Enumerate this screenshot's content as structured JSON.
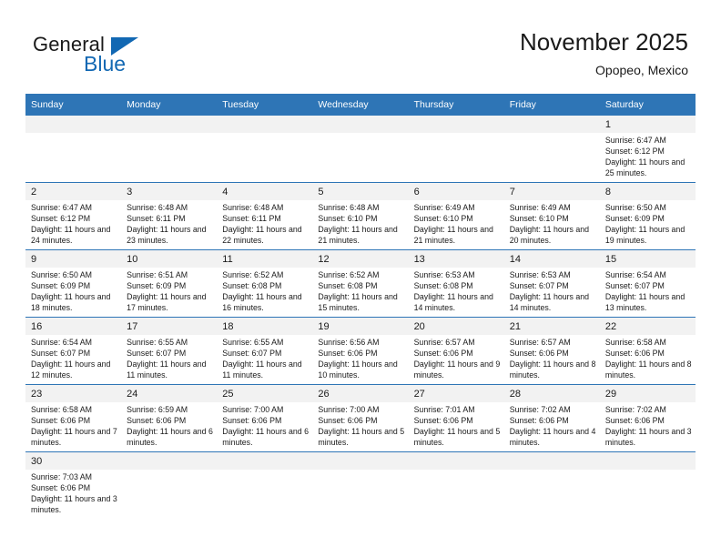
{
  "brand": {
    "name_part1": "General",
    "name_part2": "Blue"
  },
  "header": {
    "title": "November 2025",
    "location": "Opopeo, Mexico"
  },
  "colors": {
    "header_blue": "#2e75b6",
    "brand_blue": "#1268b3",
    "daynum_band": "#f2f2f2",
    "cell_background": "#ffffff",
    "text": "#1a1a1a"
  },
  "weekdays": [
    "Sunday",
    "Monday",
    "Tuesday",
    "Wednesday",
    "Thursday",
    "Friday",
    "Saturday"
  ],
  "labels": {
    "sunrise": "Sunrise:",
    "sunset": "Sunset:",
    "daylight": "Daylight:"
  },
  "weeks": [
    [
      {
        "day": "",
        "empty": true
      },
      {
        "day": "",
        "empty": true
      },
      {
        "day": "",
        "empty": true
      },
      {
        "day": "",
        "empty": true
      },
      {
        "day": "",
        "empty": true
      },
      {
        "day": "",
        "empty": true
      },
      {
        "day": "1",
        "sunrise": "Sunrise: 6:47 AM",
        "sunset": "Sunset: 6:12 PM",
        "daylight": "Daylight: 11 hours and 25 minutes."
      }
    ],
    [
      {
        "day": "2",
        "sunrise": "Sunrise: 6:47 AM",
        "sunset": "Sunset: 6:12 PM",
        "daylight": "Daylight: 11 hours and 24 minutes."
      },
      {
        "day": "3",
        "sunrise": "Sunrise: 6:48 AM",
        "sunset": "Sunset: 6:11 PM",
        "daylight": "Daylight: 11 hours and 23 minutes."
      },
      {
        "day": "4",
        "sunrise": "Sunrise: 6:48 AM",
        "sunset": "Sunset: 6:11 PM",
        "daylight": "Daylight: 11 hours and 22 minutes."
      },
      {
        "day": "5",
        "sunrise": "Sunrise: 6:48 AM",
        "sunset": "Sunset: 6:10 PM",
        "daylight": "Daylight: 11 hours and 21 minutes."
      },
      {
        "day": "6",
        "sunrise": "Sunrise: 6:49 AM",
        "sunset": "Sunset: 6:10 PM",
        "daylight": "Daylight: 11 hours and 21 minutes."
      },
      {
        "day": "7",
        "sunrise": "Sunrise: 6:49 AM",
        "sunset": "Sunset: 6:10 PM",
        "daylight": "Daylight: 11 hours and 20 minutes."
      },
      {
        "day": "8",
        "sunrise": "Sunrise: 6:50 AM",
        "sunset": "Sunset: 6:09 PM",
        "daylight": "Daylight: 11 hours and 19 minutes."
      }
    ],
    [
      {
        "day": "9",
        "sunrise": "Sunrise: 6:50 AM",
        "sunset": "Sunset: 6:09 PM",
        "daylight": "Daylight: 11 hours and 18 minutes."
      },
      {
        "day": "10",
        "sunrise": "Sunrise: 6:51 AM",
        "sunset": "Sunset: 6:09 PM",
        "daylight": "Daylight: 11 hours and 17 minutes."
      },
      {
        "day": "11",
        "sunrise": "Sunrise: 6:52 AM",
        "sunset": "Sunset: 6:08 PM",
        "daylight": "Daylight: 11 hours and 16 minutes."
      },
      {
        "day": "12",
        "sunrise": "Sunrise: 6:52 AM",
        "sunset": "Sunset: 6:08 PM",
        "daylight": "Daylight: 11 hours and 15 minutes."
      },
      {
        "day": "13",
        "sunrise": "Sunrise: 6:53 AM",
        "sunset": "Sunset: 6:08 PM",
        "daylight": "Daylight: 11 hours and 14 minutes."
      },
      {
        "day": "14",
        "sunrise": "Sunrise: 6:53 AM",
        "sunset": "Sunset: 6:07 PM",
        "daylight": "Daylight: 11 hours and 14 minutes."
      },
      {
        "day": "15",
        "sunrise": "Sunrise: 6:54 AM",
        "sunset": "Sunset: 6:07 PM",
        "daylight": "Daylight: 11 hours and 13 minutes."
      }
    ],
    [
      {
        "day": "16",
        "sunrise": "Sunrise: 6:54 AM",
        "sunset": "Sunset: 6:07 PM",
        "daylight": "Daylight: 11 hours and 12 minutes."
      },
      {
        "day": "17",
        "sunrise": "Sunrise: 6:55 AM",
        "sunset": "Sunset: 6:07 PM",
        "daylight": "Daylight: 11 hours and 11 minutes."
      },
      {
        "day": "18",
        "sunrise": "Sunrise: 6:55 AM",
        "sunset": "Sunset: 6:07 PM",
        "daylight": "Daylight: 11 hours and 11 minutes."
      },
      {
        "day": "19",
        "sunrise": "Sunrise: 6:56 AM",
        "sunset": "Sunset: 6:06 PM",
        "daylight": "Daylight: 11 hours and 10 minutes."
      },
      {
        "day": "20",
        "sunrise": "Sunrise: 6:57 AM",
        "sunset": "Sunset: 6:06 PM",
        "daylight": "Daylight: 11 hours and 9 minutes."
      },
      {
        "day": "21",
        "sunrise": "Sunrise: 6:57 AM",
        "sunset": "Sunset: 6:06 PM",
        "daylight": "Daylight: 11 hours and 8 minutes."
      },
      {
        "day": "22",
        "sunrise": "Sunrise: 6:58 AM",
        "sunset": "Sunset: 6:06 PM",
        "daylight": "Daylight: 11 hours and 8 minutes."
      }
    ],
    [
      {
        "day": "23",
        "sunrise": "Sunrise: 6:58 AM",
        "sunset": "Sunset: 6:06 PM",
        "daylight": "Daylight: 11 hours and 7 minutes."
      },
      {
        "day": "24",
        "sunrise": "Sunrise: 6:59 AM",
        "sunset": "Sunset: 6:06 PM",
        "daylight": "Daylight: 11 hours and 6 minutes."
      },
      {
        "day": "25",
        "sunrise": "Sunrise: 7:00 AM",
        "sunset": "Sunset: 6:06 PM",
        "daylight": "Daylight: 11 hours and 6 minutes."
      },
      {
        "day": "26",
        "sunrise": "Sunrise: 7:00 AM",
        "sunset": "Sunset: 6:06 PM",
        "daylight": "Daylight: 11 hours and 5 minutes."
      },
      {
        "day": "27",
        "sunrise": "Sunrise: 7:01 AM",
        "sunset": "Sunset: 6:06 PM",
        "daylight": "Daylight: 11 hours and 5 minutes."
      },
      {
        "day": "28",
        "sunrise": "Sunrise: 7:02 AM",
        "sunset": "Sunset: 6:06 PM",
        "daylight": "Daylight: 11 hours and 4 minutes."
      },
      {
        "day": "29",
        "sunrise": "Sunrise: 7:02 AM",
        "sunset": "Sunset: 6:06 PM",
        "daylight": "Daylight: 11 hours and 3 minutes."
      }
    ],
    [
      {
        "day": "30",
        "sunrise": "Sunrise: 7:03 AM",
        "sunset": "Sunset: 6:06 PM",
        "daylight": "Daylight: 11 hours and 3 minutes."
      },
      {
        "day": "",
        "empty": true
      },
      {
        "day": "",
        "empty": true
      },
      {
        "day": "",
        "empty": true
      },
      {
        "day": "",
        "empty": true
      },
      {
        "day": "",
        "empty": true
      },
      {
        "day": "",
        "empty": true
      }
    ]
  ]
}
